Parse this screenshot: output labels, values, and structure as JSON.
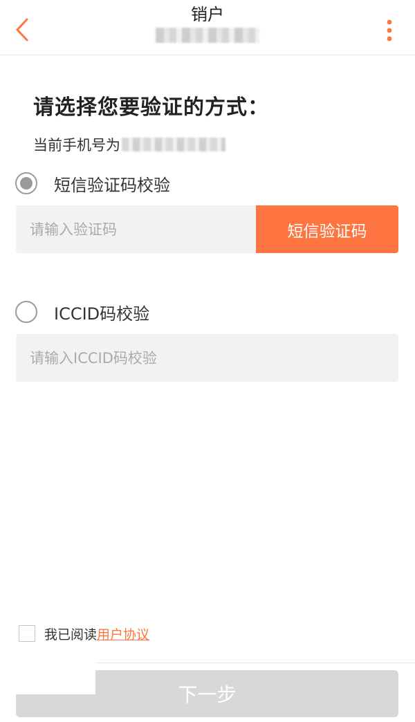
{
  "header": {
    "title": "销户",
    "back_icon": "chevron-left-icon",
    "menu_icon": "more-vertical-icon",
    "accent": "#ff7541"
  },
  "main": {
    "heading": "请选择您要验证的方式：",
    "phone_label": "当前手机号为",
    "options": [
      {
        "label": "短信验证码校验",
        "selected": true,
        "input_placeholder": "请输入验证码",
        "button_label": "短信验证码"
      },
      {
        "label": "ICCID码校验",
        "selected": false,
        "input_placeholder": "请输入ICCID码校验"
      }
    ]
  },
  "footer": {
    "agree_text": "我已阅读",
    "agree_link": "用户协议",
    "next_label": "下一步"
  },
  "colors": {
    "accent": "#ff7541",
    "input_bg": "#f2f2f2",
    "disabled_button": "#d8d8d8"
  }
}
